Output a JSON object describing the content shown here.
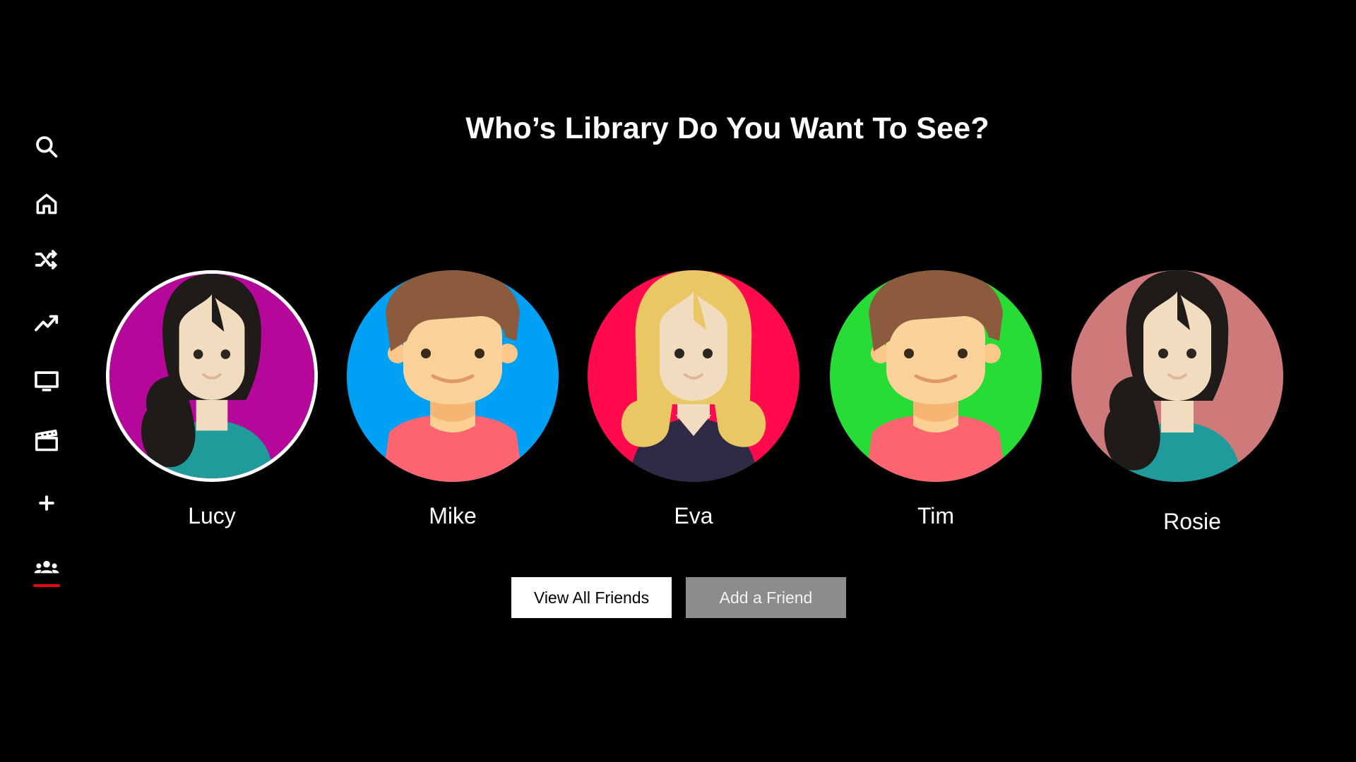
{
  "sidebar": {
    "items": [
      {
        "icon": "search-icon"
      },
      {
        "icon": "home-icon"
      },
      {
        "icon": "shuffle-icon"
      },
      {
        "icon": "trending-icon"
      },
      {
        "icon": "tv-icon"
      },
      {
        "icon": "movie-clapper-icon"
      },
      {
        "icon": "plus-icon"
      },
      {
        "icon": "friends-icon",
        "active": true
      }
    ],
    "active_indicator_color": "#e50914"
  },
  "page_title": "Who’s Library Do You Want To See?",
  "profiles": [
    {
      "name": "Lucy",
      "avatar_bg": "#b5089a",
      "selected": true
    },
    {
      "name": "Mike",
      "avatar_bg": "#00a0f5",
      "selected": false
    },
    {
      "name": "Eva",
      "avatar_bg": "#ff0a4c",
      "selected": false
    },
    {
      "name": "Tim",
      "avatar_bg": "#27dd35",
      "selected": false
    },
    {
      "name": "Rosie",
      "avatar_bg": "#cf7a7a",
      "selected": false
    }
  ],
  "buttons": {
    "view_all": "View All Friends",
    "add_friend": "Add a Friend"
  }
}
